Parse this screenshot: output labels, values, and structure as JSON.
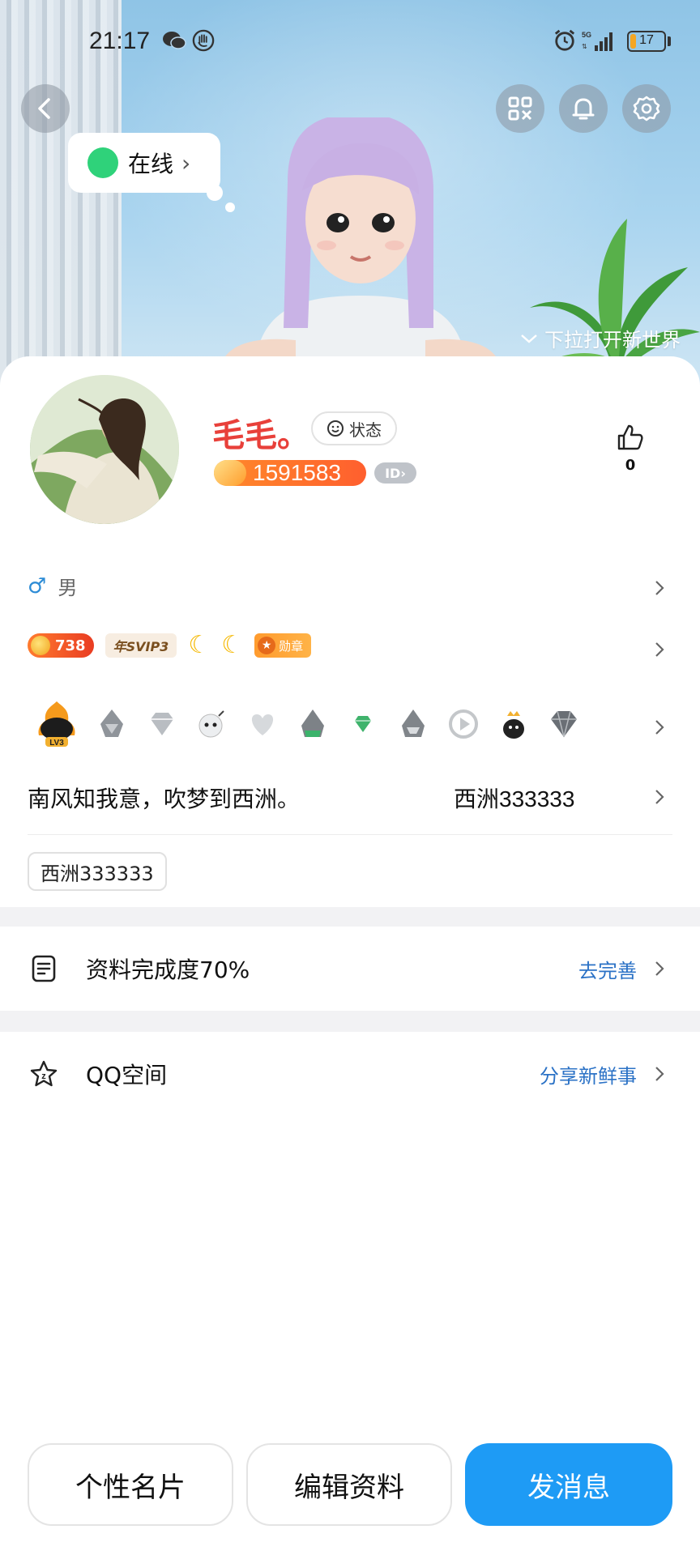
{
  "status_bar": {
    "time": "21:17",
    "battery": "17",
    "battery_level": 0.17
  },
  "hero": {
    "online_label": "在线",
    "pull_hint": "下拉打开新世界"
  },
  "profile": {
    "nickname": "毛毛。",
    "status_label": "状态",
    "uid": "1591583",
    "id_badge": "ID",
    "likes": "0"
  },
  "gender": {
    "label": "男",
    "symbol": "♂"
  },
  "badges": {
    "level": "738",
    "svip": "年SVIP3",
    "medal": "勋章"
  },
  "signature": {
    "text": "南风知我意，吹梦到西洲。",
    "right": "西洲333333"
  },
  "tag": "西洲333333",
  "completion": {
    "label": "资料完成度70%",
    "action": "去完善"
  },
  "qzone": {
    "label": "QQ空间",
    "action": "分享新鲜事"
  },
  "buttons": {
    "card": "个性名片",
    "edit": "编辑资料",
    "message": "发消息"
  },
  "colors": {
    "nickname": "#e8403a",
    "primary": "#1e9bf5",
    "link": "#2b72c6",
    "online": "#2fd27a"
  }
}
